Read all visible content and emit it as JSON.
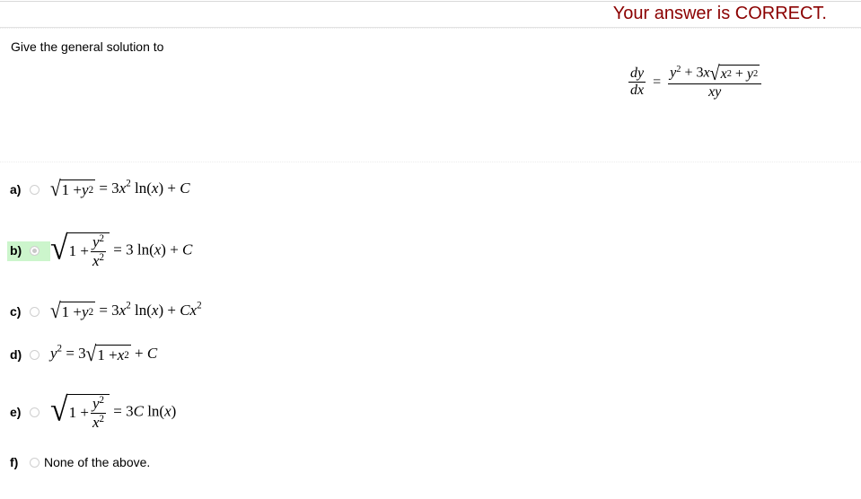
{
  "result": {
    "message": "Your answer is CORRECT.",
    "color": "#8b0000"
  },
  "question": {
    "prompt": "Give the general solution to",
    "equation": {
      "lhs_num": "dy",
      "lhs_den": "dx",
      "eq": "=",
      "rhs_num_a": "y",
      "rhs_num_b": " + 3x",
      "rhs_sqrt": "x² + y²",
      "rhs_den": "xy"
    }
  },
  "options": [
    {
      "label": "a)",
      "selected": false,
      "text": "√(1 + y²) = 3x² ln(x) + C"
    },
    {
      "label": "b)",
      "selected": true,
      "highlight": "#ccf5cc",
      "text": "√(1 + y²/x²) = 3 ln(x) + C"
    },
    {
      "label": "c)",
      "selected": false,
      "text": "√(1 + y²) = 3x² ln(x) + Cx²"
    },
    {
      "label": "d)",
      "selected": false,
      "text": "y² = 3√(1 + x²) + C"
    },
    {
      "label": "e)",
      "selected": false,
      "text": "√(1 + y²/x²) = 3C ln(x)"
    },
    {
      "label": "f)",
      "selected": false,
      "text": "None of the above."
    }
  ]
}
